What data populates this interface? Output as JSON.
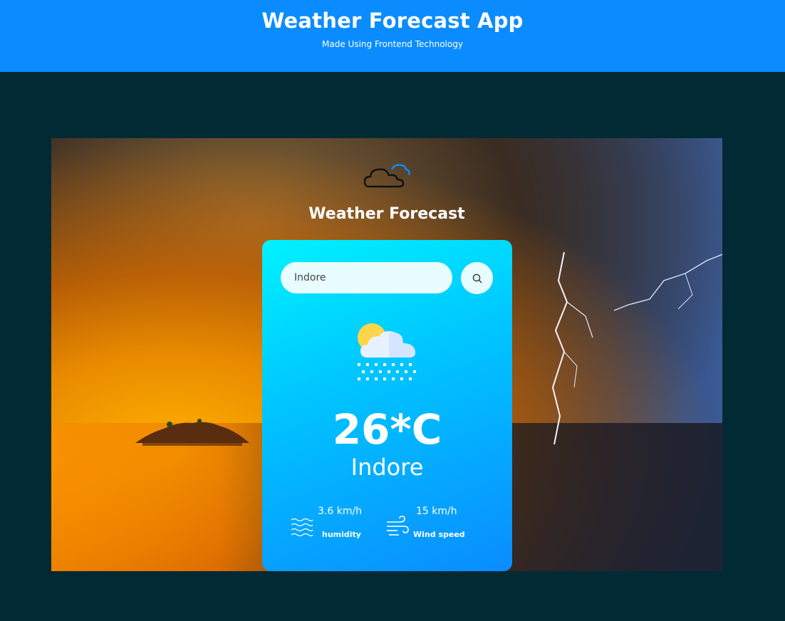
{
  "header": {
    "title": "Weather Forecast App",
    "subtitle": "Made Using Frontend Technology"
  },
  "hero": {
    "title": "Weather Forecast",
    "logo_icon": "cloud-icon"
  },
  "search": {
    "value": "Indore",
    "button_icon": "search-icon"
  },
  "weather": {
    "icon": "partly-cloudy-snow-icon",
    "temperature": "26*C",
    "city": "Indore",
    "humidity": {
      "value": "3.6 km/h",
      "label": "humidity",
      "icon": "waves-icon"
    },
    "wind": {
      "value": "15 km/h",
      "label": "Wind speed",
      "icon": "wind-icon"
    }
  },
  "colors": {
    "header_bg": "#0a8cff",
    "page_bg": "#022a35",
    "card_gradient_start": "#00f2ff",
    "card_gradient_end": "#0a8cff"
  }
}
